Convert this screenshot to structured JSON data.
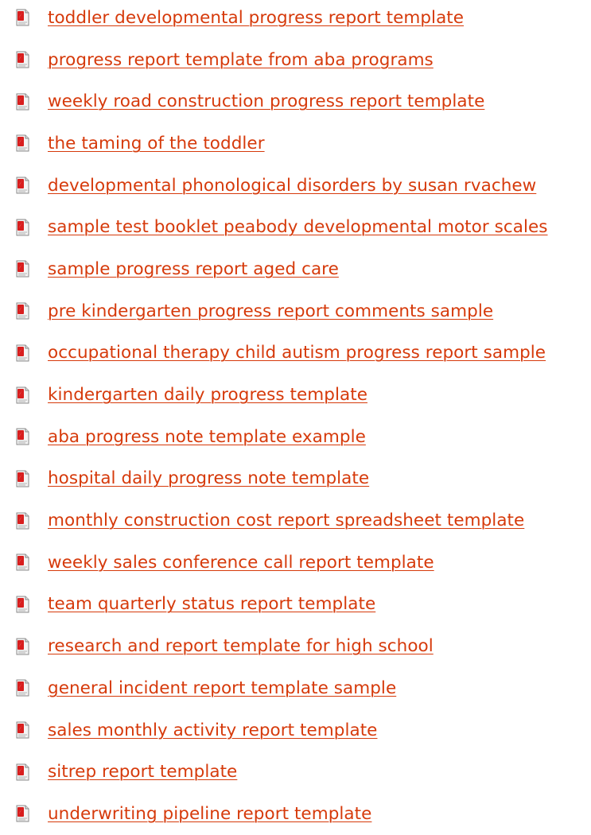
{
  "icon": {
    "name": "pdf-icon",
    "accent": "#d81e1e",
    "link_color": "#d63a0b"
  },
  "items": [
    {
      "label": "toddler developmental progress report template"
    },
    {
      "label": "progress report template from aba programs"
    },
    {
      "label": "weekly road construction progress report template"
    },
    {
      "label": "the taming of the toddler"
    },
    {
      "label": "developmental phonological disorders by susan rvachew"
    },
    {
      "label": "sample test booklet peabody developmental motor scales"
    },
    {
      "label": "sample progress report aged care"
    },
    {
      "label": "pre kindergarten progress report comments sample"
    },
    {
      "label": "occupational therapy child autism progress report sample"
    },
    {
      "label": "kindergarten daily progress template"
    },
    {
      "label": "aba progress note template example"
    },
    {
      "label": "hospital daily progress note template"
    },
    {
      "label": "monthly construction cost report spreadsheet template"
    },
    {
      "label": "weekly sales conference call report template"
    },
    {
      "label": "team quarterly status report template"
    },
    {
      "label": "research and report template for high school"
    },
    {
      "label": "general incident report template sample"
    },
    {
      "label": "sales monthly activity report template"
    },
    {
      "label": "sitrep report template"
    },
    {
      "label": "underwriting pipeline report template"
    }
  ]
}
